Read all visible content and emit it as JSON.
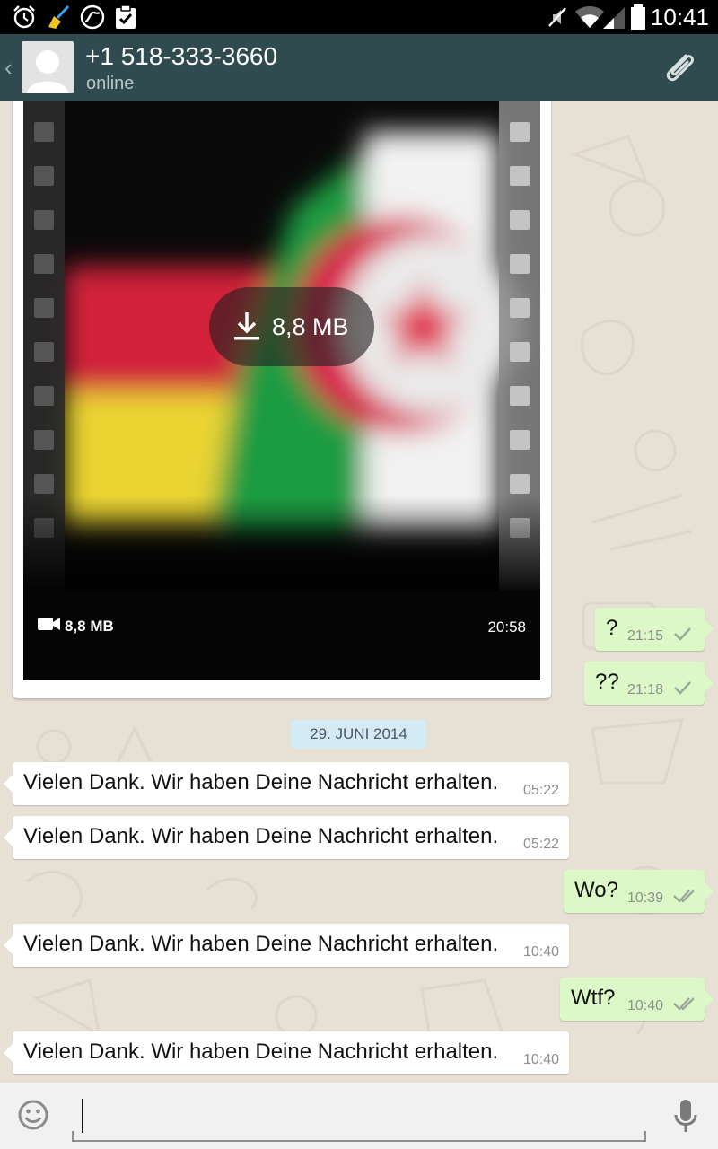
{
  "status_bar": {
    "time": "10:41",
    "left_icons": [
      "alarm-icon",
      "broom-icon",
      "sync-icon",
      "clipboard-check-icon"
    ],
    "right_icons": [
      "mute-icon",
      "wifi-icon",
      "signal-icon",
      "battery-icon"
    ]
  },
  "header": {
    "contact_name": "+1 518-333-3660",
    "status": "online",
    "back_glyph": "‹",
    "attach_icon": "paperclip-icon"
  },
  "video_message": {
    "download_label": "8,8 MB",
    "size_label": "8,8 MB",
    "time": "20:58",
    "thumbnail_description_icon": "video-camera-icon"
  },
  "messages": [
    {
      "dir": "out",
      "text": "?",
      "time": "21:15",
      "status": "sent"
    },
    {
      "dir": "out",
      "text": "??",
      "time": "21:18",
      "status": "sent"
    },
    {
      "dir": "in",
      "text": "Vielen Dank. Wir haben Deine Nachricht erhalten.",
      "time": "05:22"
    },
    {
      "dir": "in",
      "text": "Vielen Dank. Wir haben Deine Nachricht erhalten.",
      "time": "05:22"
    },
    {
      "dir": "out",
      "text": "Wo?",
      "time": "10:39",
      "status": "delivered"
    },
    {
      "dir": "in",
      "text": "Vielen Dank. Wir haben Deine Nachricht erhalten.",
      "time": "10:40"
    },
    {
      "dir": "out",
      "text": "Wtf?",
      "time": "10:40",
      "status": "delivered"
    },
    {
      "dir": "in",
      "text": "Vielen Dank. Wir haben Deine Nachricht erhalten.",
      "time": "10:40"
    }
  ],
  "date_divider": "29. JUNI 2014",
  "composer": {
    "value": "",
    "emoji_icon": "smiley-icon",
    "mic_icon": "microphone-icon"
  },
  "colors": {
    "action_bar": "#2f4b4f",
    "outgoing_bubble": "#dcf8c6",
    "incoming_bubble": "#ffffff",
    "chat_background": "#e6e0d5",
    "date_chip": "#d4eaf4"
  }
}
